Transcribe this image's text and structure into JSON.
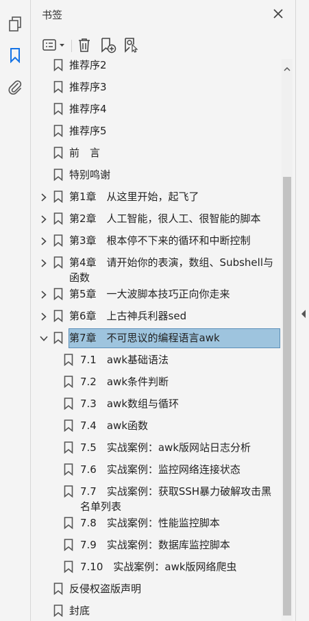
{
  "panel": {
    "title": "书签"
  },
  "toolbar": {
    "options_icon": "list-options-icon",
    "delete_icon": "trash-icon",
    "new_bookmark_icon": "new-bookmark-icon",
    "bookmark_from_selection_icon": "bookmark-selection-icon"
  },
  "rail": {
    "icons": [
      "pages-icon",
      "bookmark-icon",
      "attachment-icon"
    ]
  },
  "bookmarks": [
    {
      "label": "推荐序2",
      "level": 0,
      "expandable": false,
      "cut": true
    },
    {
      "label": "推荐序3",
      "level": 0,
      "expandable": false
    },
    {
      "label": "推荐序4",
      "level": 0,
      "expandable": false
    },
    {
      "label": "推荐序5",
      "level": 0,
      "expandable": false
    },
    {
      "label": "前　言",
      "level": 0,
      "expandable": false
    },
    {
      "label": "特别鸣谢",
      "level": 0,
      "expandable": false
    },
    {
      "label": "第1章　从这里开始，起飞了",
      "level": 0,
      "expandable": true,
      "expanded": false
    },
    {
      "label": "第2章　人工智能，很人工、很智能的脚本",
      "level": 0,
      "expandable": true,
      "expanded": false
    },
    {
      "label": "第3章　根本停不下来的循环和中断控制",
      "level": 0,
      "expandable": true,
      "expanded": false
    },
    {
      "label": "第4章　请开始你的表演，数组、Subshell与函数",
      "level": 0,
      "expandable": true,
      "expanded": false,
      "wrap": true
    },
    {
      "label": "第5章　一大波脚本技巧正向你走来",
      "level": 0,
      "expandable": true,
      "expanded": false
    },
    {
      "label": "第6章　上古神兵利器sed",
      "level": 0,
      "expandable": true,
      "expanded": false
    },
    {
      "label": "第7章　不可思议的编程语言awk",
      "level": 0,
      "expandable": true,
      "expanded": true,
      "selected": true
    },
    {
      "label": "7.1　awk基础语法",
      "level": 1
    },
    {
      "label": "7.2　awk条件判断",
      "level": 1
    },
    {
      "label": "7.3　awk数组与循环",
      "level": 1
    },
    {
      "label": "7.4　awk函数",
      "level": 1
    },
    {
      "label": "7.5　实战案例：awk版网站日志分析",
      "level": 1
    },
    {
      "label": "7.6　实战案例：监控网络连接状态",
      "level": 1
    },
    {
      "label": "7.7　实战案例：获取SSH暴力破解攻击黑名单列表",
      "level": 1,
      "wrap": true
    },
    {
      "label": "7.8　实战案例：性能监控脚本",
      "level": 1
    },
    {
      "label": "7.9　实战案例：数据库监控脚本",
      "level": 1
    },
    {
      "label": "7.10　实战案例：awk版网络爬虫",
      "level": 1
    },
    {
      "label": "反侵权盗版声明",
      "level": 0,
      "expandable": false
    },
    {
      "label": "封底",
      "level": 0,
      "expandable": false
    }
  ]
}
